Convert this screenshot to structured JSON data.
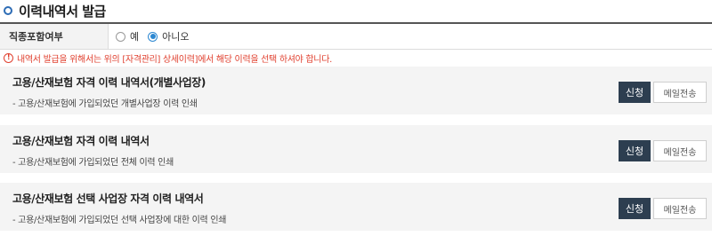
{
  "section": {
    "title": "이력내역서 발급"
  },
  "option": {
    "label": "직종포함여부",
    "choices": [
      {
        "label": "예",
        "selected": false
      },
      {
        "label": "아니오",
        "selected": true
      }
    ]
  },
  "notice": {
    "icon": "!",
    "text": "내역서 발급을 위해서는 위의 [자격관리] 상세이력]에서 해당 이력을 선택 하셔야 합니다."
  },
  "cards": [
    {
      "title": "고용/산재보험 자격 이력 내역서(개별사업장)",
      "desc": "- 고용/산재보험에 가입되었던 개별사업장 이력 인쇄",
      "apply_label": "신청",
      "mail_label": "메일전송"
    },
    {
      "title": "고용/산재보험 자격 이력 내역서",
      "desc": "- 고용/산재보험에 가입되었던 전체 이력 인쇄",
      "apply_label": "신청",
      "mail_label": "메일전송"
    },
    {
      "title": "고용/산재보험 선택 사업장 자격 이력 내역서",
      "desc": "- 고용/산재보험에 가입되었던 선택 사업장에 대한 이력 인쇄",
      "apply_label": "신청",
      "mail_label": "메일전송"
    }
  ],
  "colors": {
    "accent": "#2d6cb5",
    "radio_active": "#2b87d1",
    "warning": "#e0402f",
    "button_dark": "#2d3e50"
  }
}
